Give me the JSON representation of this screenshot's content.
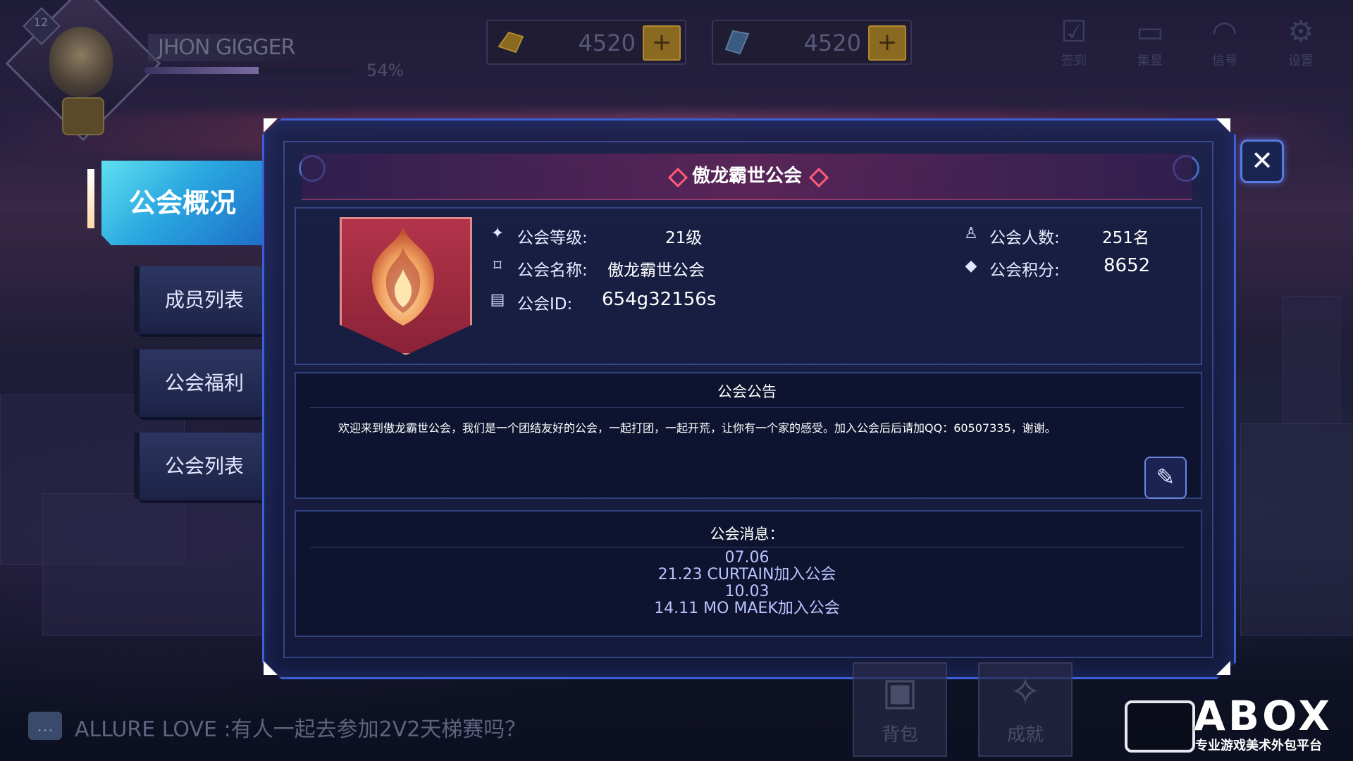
{
  "player": {
    "name": "JHON GIGGER",
    "level": "12",
    "xp_text": "54%",
    "xp_fraction": 0.54
  },
  "currencies": [
    {
      "name": "gold",
      "icon": "gold-ingot-icon",
      "value": "4520"
    },
    {
      "name": "crystal",
      "icon": "crystal-icon",
      "value": "4520"
    }
  ],
  "top_icons": [
    {
      "id": "checkin",
      "icon": "calendar-check-icon",
      "label": "签到"
    },
    {
      "id": "collect",
      "icon": "tv-icon",
      "label": "集显"
    },
    {
      "id": "signal",
      "icon": "wifi-icon",
      "label": "信号"
    },
    {
      "id": "settings",
      "icon": "gear-icon",
      "label": "设置"
    }
  ],
  "nav": {
    "active": "公会概况",
    "items": [
      "成员列表",
      "公会福利",
      "公会列表"
    ]
  },
  "guild": {
    "title": "傲龙霸世公会",
    "level_label": "公会等级:",
    "level_value": "21级",
    "name_label": "公会名称:",
    "name_value": "傲龙霸世公会",
    "id_label": "公会ID:",
    "id_value": "654g32156s",
    "members_label": "公会人数:",
    "members_value": "251名",
    "points_label": "公会积分:",
    "points_value": "8652"
  },
  "notice": {
    "title": "公会公告",
    "text": "欢迎来到傲龙霸世公会，我们是一个团结友好的公会，一起打团，一起开荒，让你有一个家的感受。加入公会后后请加QQ：60507335，谢谢。"
  },
  "messages": {
    "title": "公会消息：",
    "lines": [
      "07.06",
      "21.23   CURTAIN加入公会",
      "10.03",
      "14.11 MO MAEK加入公会"
    ]
  },
  "chat": {
    "text": "ALLURE LOVE :有人一起去参加2V2天梯赛吗？"
  },
  "dock": [
    {
      "id": "bag",
      "icon": "backpack-icon",
      "label": "背包"
    },
    {
      "id": "achievement",
      "icon": "trophy-icon",
      "label": "成就"
    }
  ],
  "watermark": {
    "brand": "ABOX",
    "subtitle": "专业游戏美术外包平台"
  },
  "colors": {
    "accent": "#3d5fd6",
    "nav_active": "#2aa8e0",
    "title_diamond": "#ff5a7a",
    "emblem": "#b3344a"
  }
}
